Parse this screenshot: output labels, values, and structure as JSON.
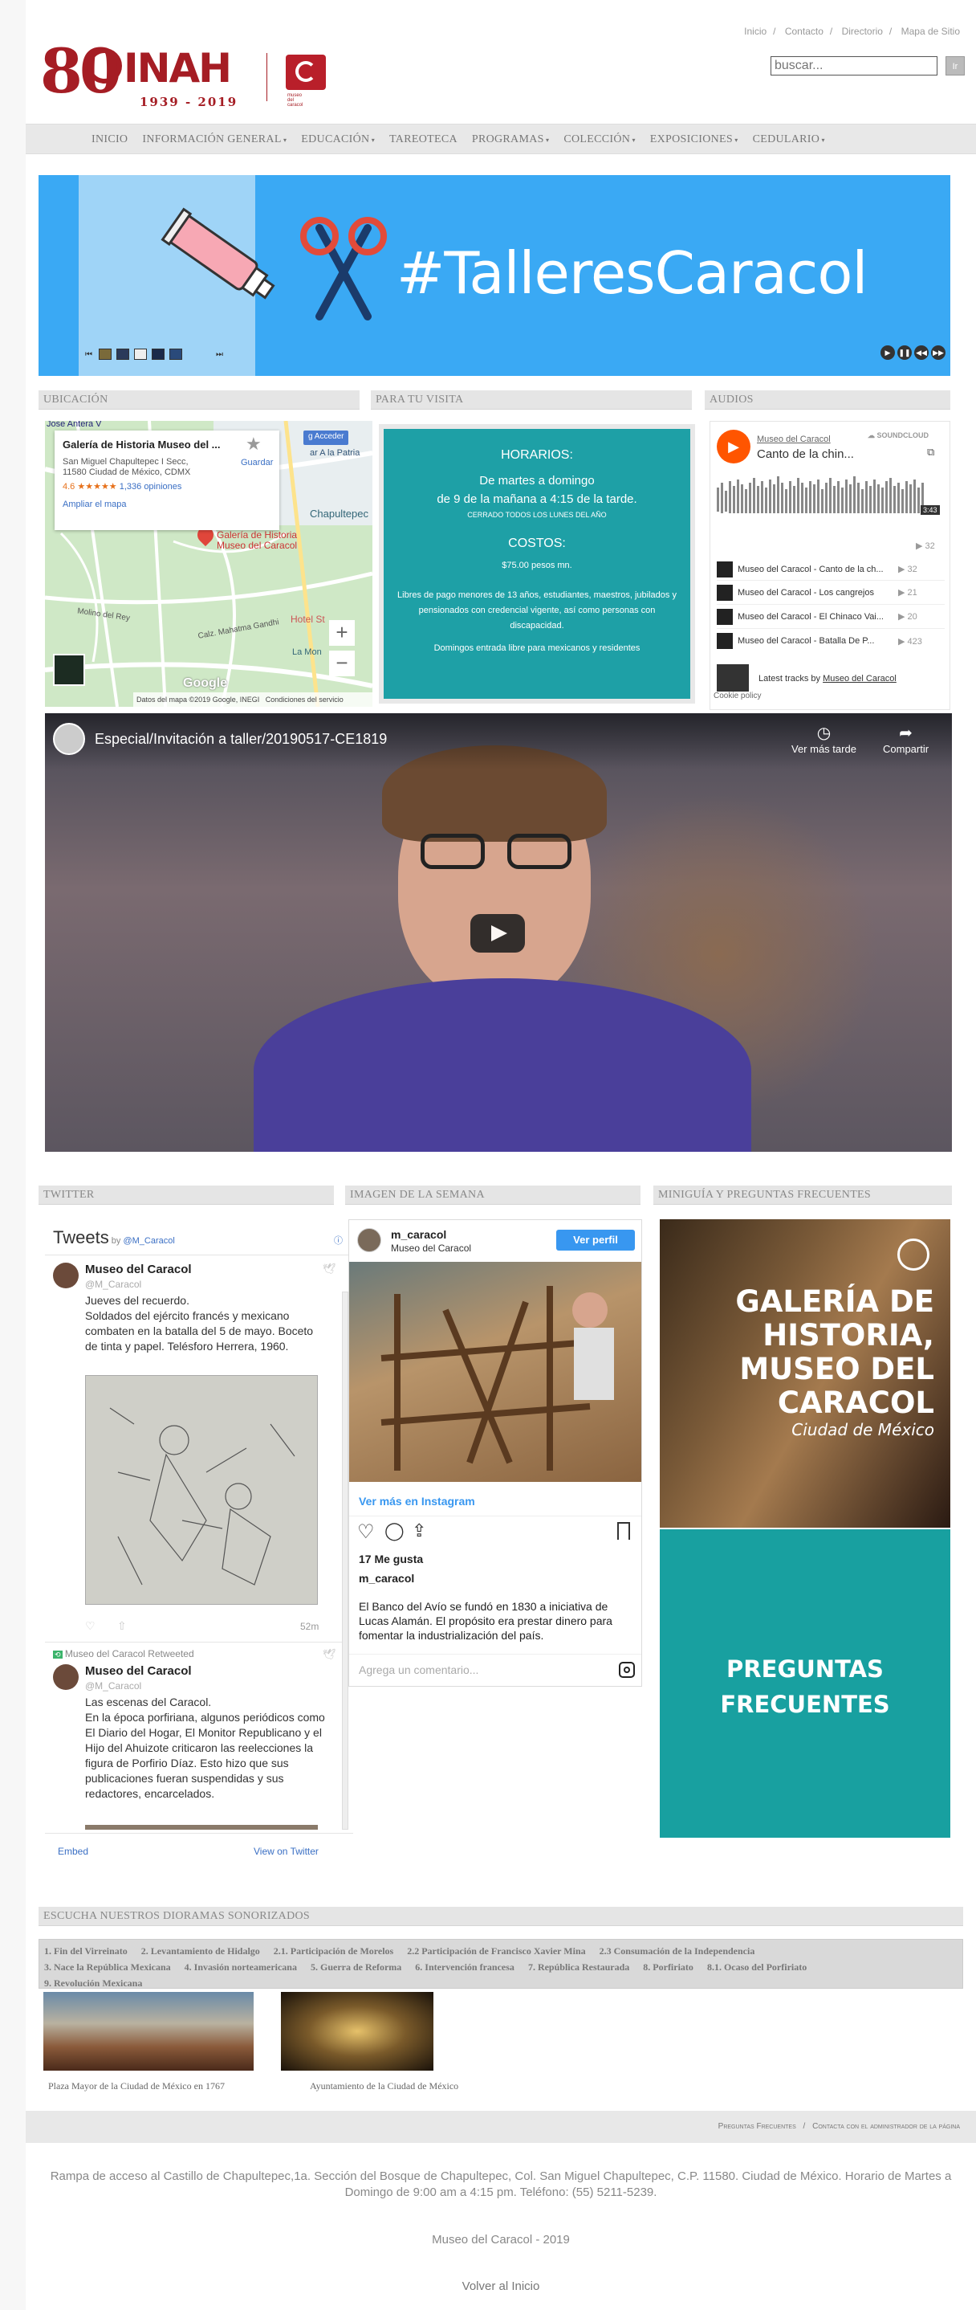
{
  "top_links": [
    "Inicio",
    "Contacto",
    "Directorio",
    "Mapa de Sitio"
  ],
  "logo": {
    "number": "80",
    "name": "INAH",
    "years": "1939 - 2019",
    "museum": "museo del caracol"
  },
  "search": {
    "placeholder": "buscar...",
    "button": "Ir"
  },
  "nav": [
    "INICIO",
    "INFORMACIÓN GENERAL",
    "EDUCACIÓN",
    "TAREOTECA",
    "PROGRAMAS",
    "COLECCIÓN",
    "EXPOSICIONES",
    "CEDULARIO"
  ],
  "hero": {
    "title": "#TalleresCaracol"
  },
  "sections": {
    "ubicacion": "UBICACIÓN",
    "visita": "PARA TU VISITA",
    "audios": "AUDIOS",
    "twitter": "TWITTER",
    "imagen": "IMAGEN DE LA SEMANA",
    "miniguia": "MINIGUÍA Y PREGUNTAS FRECUENTES",
    "dioramas": "ESCUCHA NUESTROS DIORAMAS SONORIZADOS"
  },
  "map": {
    "name": "Galería de Historia Museo del ...",
    "address1": "San Miguel Chapultepec I Secc,",
    "address2": "11580 Ciudad de México, CDMX",
    "rating": "4.6",
    "stars": "★★★★★",
    "reviews": "1,336 opiniones",
    "save": "Guardar",
    "expand": "Ampliar el mapa",
    "acceder": "Acceder",
    "pin_label1": "Galería de Historia",
    "pin_label2": "Museo del Caracol",
    "label_chapultepec": "Chapultepec",
    "label_patria": "ar A la Patria",
    "label_anteria": "Jose Antera V",
    "label_hotel": "Hotel St",
    "label_lamon": "La Mon",
    "label_gandhi": "Calz. Mahatma Gandhi",
    "label_rey": "Molino del Rey",
    "footer": "Datos del mapa ©2019 Google, INEGI",
    "terms": "Condiciones del servicio",
    "zoom_in": "+",
    "zoom_out": "−"
  },
  "visit": {
    "h1": "HORARIOS:",
    "l1": "De martes a domingo",
    "l2": "de 9 de la mañana a 4:15 de la tarde.",
    "small": "CERRADO TODOS LOS LUNES DEL AÑO",
    "h2": "COSTOS:",
    "price": "$75.00 pesos mn.",
    "free1": "Libres de pago menores de 13 años, estudiantes, maestros, jubilados y pensionados con credencial vigente, así como personas con discapacidad.",
    "free2": "Domingos entrada libre para mexicanos y residentes"
  },
  "audio": {
    "user": "Museo del Caracol",
    "track": "Canto de la chin...",
    "brand": "SOUNDCLOUD",
    "time": "3:43",
    "count_main": "32",
    "tracks": [
      {
        "title": "Museo del Caracol - Canto de la ch...",
        "plays": "32"
      },
      {
        "title": "Museo del Caracol - Los cangrejos",
        "plays": "21"
      },
      {
        "title": "Museo del Caracol - El Chinaco Vai...",
        "plays": "20"
      },
      {
        "title": "Museo del Caracol - Batalla De P...",
        "plays": "423"
      }
    ],
    "latest": "Latest tracks by",
    "latest_user": "Museo del Caracol",
    "cookie": "Cookie policy"
  },
  "video": {
    "title": "Especial/Invitación a taller/20190517-CE1819",
    "later": "Ver más tarde",
    "share": "Compartir"
  },
  "twitter": {
    "header": "Tweets",
    "by": "by",
    "handle": "@M_Caracol",
    "tweets": [
      {
        "name": "Museo del Caracol",
        "handle": "@M_Caracol",
        "text": "Jueves del recuerdo.\nSoldados del ejército francés y mexicano combaten en la batalla del 5 de mayo. Boceto de tinta y papel. Telésforo Herrera, 1960.",
        "time": "52m"
      },
      {
        "retweet": "Museo del Caracol Retweeted",
        "name": "Museo del Caracol",
        "handle": "@M_Caracol",
        "text": "Las escenas del Caracol.\nEn la época porfiriana, algunos periódicos como El Diario del Hogar, El Monitor Republicano y el Hijo del Ahuizote criticaron las reelecciones la figura de Porfirio Díaz. Esto hizo que sus publicaciones fueran suspendidas y sus redactores, encarcelados."
      }
    ],
    "embed": "Embed",
    "view": "View on Twitter"
  },
  "instagram": {
    "user": "m_caracol",
    "sub": "Museo del Caracol",
    "profile_btn": "Ver perfil",
    "more": "Ver más en Instagram",
    "likes": "17 Me gusta",
    "caption_user": "m_caracol",
    "caption": "El Banco del Avío se fundó en 1830 a iniciativa de Lucas Alamán. El propósito era prestar dinero para fomentar la industrialización del país.",
    "comment": "Agrega un comentario..."
  },
  "miniguia": {
    "t1": "GALERÍA DE",
    "t2": "HISTORIA,",
    "t3": "MUSEO DEL",
    "t4": "CARACOL",
    "t5": "Ciudad de México",
    "faq1": "PREGUNTAS",
    "faq2": "FRECUENTES"
  },
  "dioramas": {
    "items": [
      "1. Fin del Virreinato",
      "2. Levantamiento de Hidalgo",
      "2.1. Participación de Morelos",
      "2.2 Participación de Francisco Xavier Mina",
      "2.3 Consumación de la Independencia",
      "3. Nace la República Mexicana",
      "4. Invasión norteamericana",
      "5. Guerra de Reforma",
      "6. Intervención francesa",
      "7. República Restaurada",
      "8. Porfiriato",
      "8.1. Ocaso del Porfiriato",
      "9. Revolución Mexicana"
    ],
    "cap1": "Plaza Mayor de la Ciudad de México en 1767",
    "cap2": "Ayuntamiento de la Ciudad de México"
  },
  "footer": {
    "links": [
      "Preguntas Frecuentes",
      "Contacta con el administrador de la página"
    ],
    "address": "Rampa de acceso al Castillo de Chapultepec,1a. Sección del Bosque de Chapultepec, Col. San Miguel Chapultepec, C.P. 11580. Ciudad de México. Horario de Martes a Domingo de 9:00 am a 4:15 pm. Teléfono: (55) 5211-5239.",
    "copy": "Museo del Caracol - 2019",
    "back": "Volver al Inicio"
  }
}
